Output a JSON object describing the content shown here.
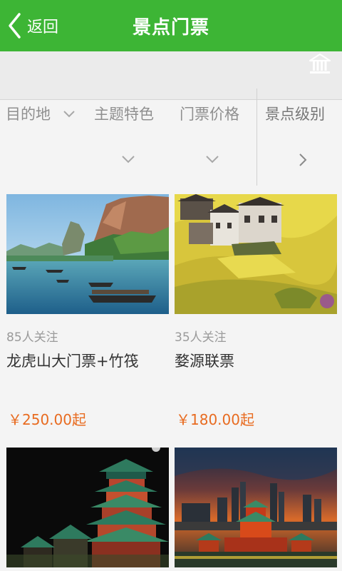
{
  "header": {
    "back_label": "返回",
    "title": "景点门票",
    "color": "#3db535"
  },
  "toolbar": {
    "home_icon": "home-icon"
  },
  "filters": [
    {
      "label": "目的地"
    },
    {
      "label": "主题特色"
    },
    {
      "label": "门票价格"
    },
    {
      "label": "景点级别"
    }
  ],
  "cards": [
    {
      "follow": "85人关注",
      "name": "龙虎山大门票+竹筏",
      "price": "￥250.00起"
    },
    {
      "follow": "35人关注",
      "name": "婺源联票",
      "price": "￥180.00起"
    },
    {
      "follow": "",
      "name": "",
      "price": ""
    },
    {
      "follow": "",
      "name": "",
      "price": ""
    }
  ],
  "colors": {
    "price": "#e86b20",
    "accent": "#3db535"
  }
}
